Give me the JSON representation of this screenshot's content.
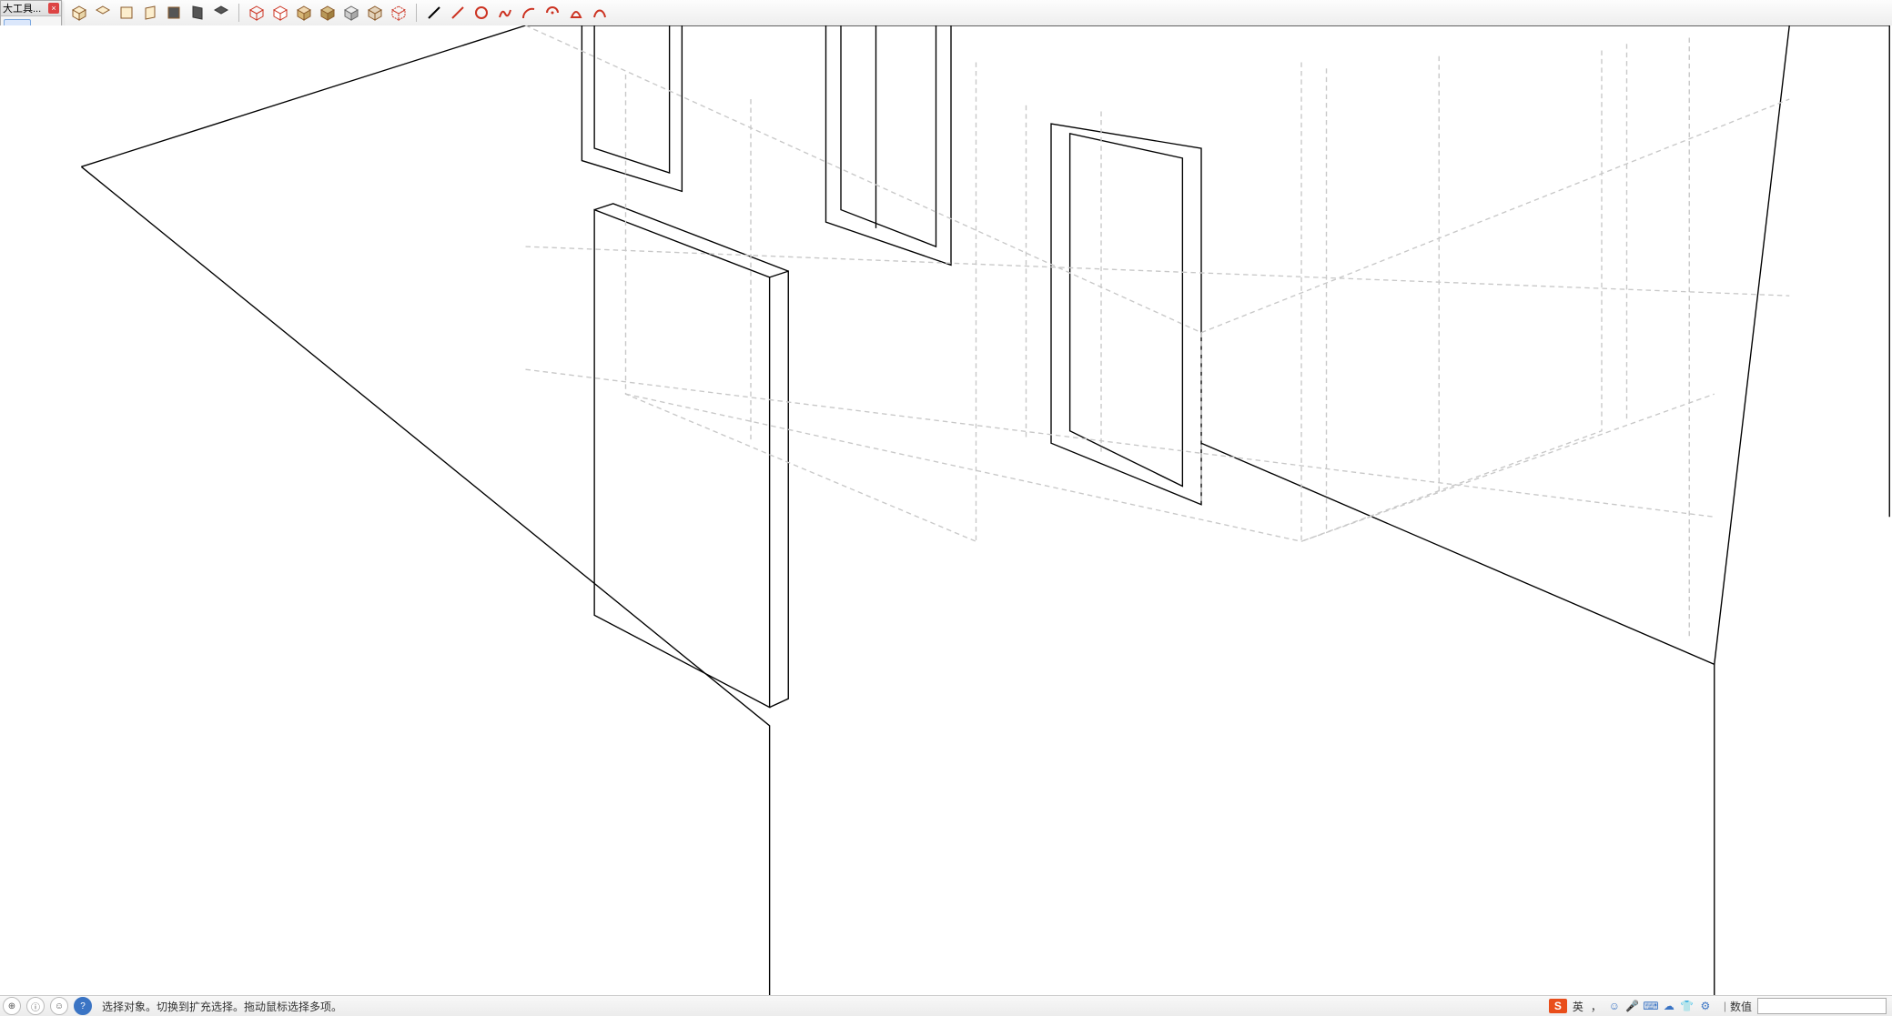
{
  "palette": {
    "title": "大工具...",
    "tools": [
      {
        "name": "select-tool",
        "sel": true
      },
      {
        "name": "make-component-tool"
      },
      {
        "name": "paint-bucket-tool"
      },
      {
        "name": "eraser-tool"
      },
      {
        "name": "rectangle-tool"
      },
      {
        "name": "line-tool"
      },
      {
        "name": "circle-tool"
      },
      {
        "name": "freehand-tool"
      },
      {
        "name": "polygon-tool"
      },
      {
        "name": "arc-tool"
      },
      {
        "name": "pie-arc-tool"
      },
      {
        "name": "bezier-tool"
      },
      {
        "name": "move-tool"
      },
      {
        "name": "pushpull-tool"
      },
      {
        "name": "rotate-tool"
      },
      {
        "name": "followme-tool"
      },
      {
        "name": "scale-tool"
      },
      {
        "name": "offset-tool"
      },
      {
        "name": "tape-measure-tool"
      },
      {
        "name": "dimension-tool"
      },
      {
        "name": "protractor-tool"
      },
      {
        "name": "text-tool"
      },
      {
        "name": "axes-tool"
      },
      {
        "name": "3dtext-tool"
      },
      {
        "name": "orbit-tool"
      },
      {
        "name": "pan-tool"
      },
      {
        "name": "zoom-tool"
      },
      {
        "name": "zoom-window-tool"
      },
      {
        "name": "zoom-prev-tool"
      },
      {
        "name": "zoom-extents-tool"
      },
      {
        "name": "position-camera-tool"
      },
      {
        "name": "look-around-tool"
      },
      {
        "name": "walk-tool"
      },
      {
        "name": "section-plane-tool"
      }
    ]
  },
  "top_toolbar": {
    "groups": [
      [
        {
          "name": "view-iso-icon"
        },
        {
          "name": "view-top-icon"
        },
        {
          "name": "view-front-icon"
        },
        {
          "name": "view-right-icon"
        },
        {
          "name": "view-back-icon"
        },
        {
          "name": "view-left-icon"
        },
        {
          "name": "view-bottom-icon"
        }
      ],
      [
        {
          "name": "style-wireframe-icon"
        },
        {
          "name": "style-hidden-icon"
        },
        {
          "name": "style-shaded-icon"
        },
        {
          "name": "style-shaded-tex-icon"
        },
        {
          "name": "style-mono-icon"
        },
        {
          "name": "style-xray-icon"
        },
        {
          "name": "style-back-edge-icon"
        }
      ],
      [
        {
          "name": "edge-line-icon"
        },
        {
          "name": "edge-pencil-icon"
        },
        {
          "name": "edge-circle-icon"
        },
        {
          "name": "edge-freehand-icon"
        },
        {
          "name": "edge-arc1-icon"
        },
        {
          "name": "edge-arc2-icon"
        },
        {
          "name": "edge-arc3-icon"
        },
        {
          "name": "edge-bezier-icon"
        }
      ]
    ]
  },
  "status": {
    "message": "选择对象。切换到扩充选择。拖动鼠标选择多项。",
    "value_label": "数值",
    "ime": {
      "logo": "S",
      "lang": "英",
      "punct": "，",
      "emoji": "☺",
      "mic": "🎤",
      "keyboard": "⌨",
      "cloud": "☁",
      "shirt": "👕",
      "settings": "⚙"
    }
  },
  "colors": {
    "red": "#cc3322",
    "brown": "#8a5a2a",
    "blue": "#3a74c4",
    "green": "#3a9a3a",
    "gray": "#888888"
  }
}
